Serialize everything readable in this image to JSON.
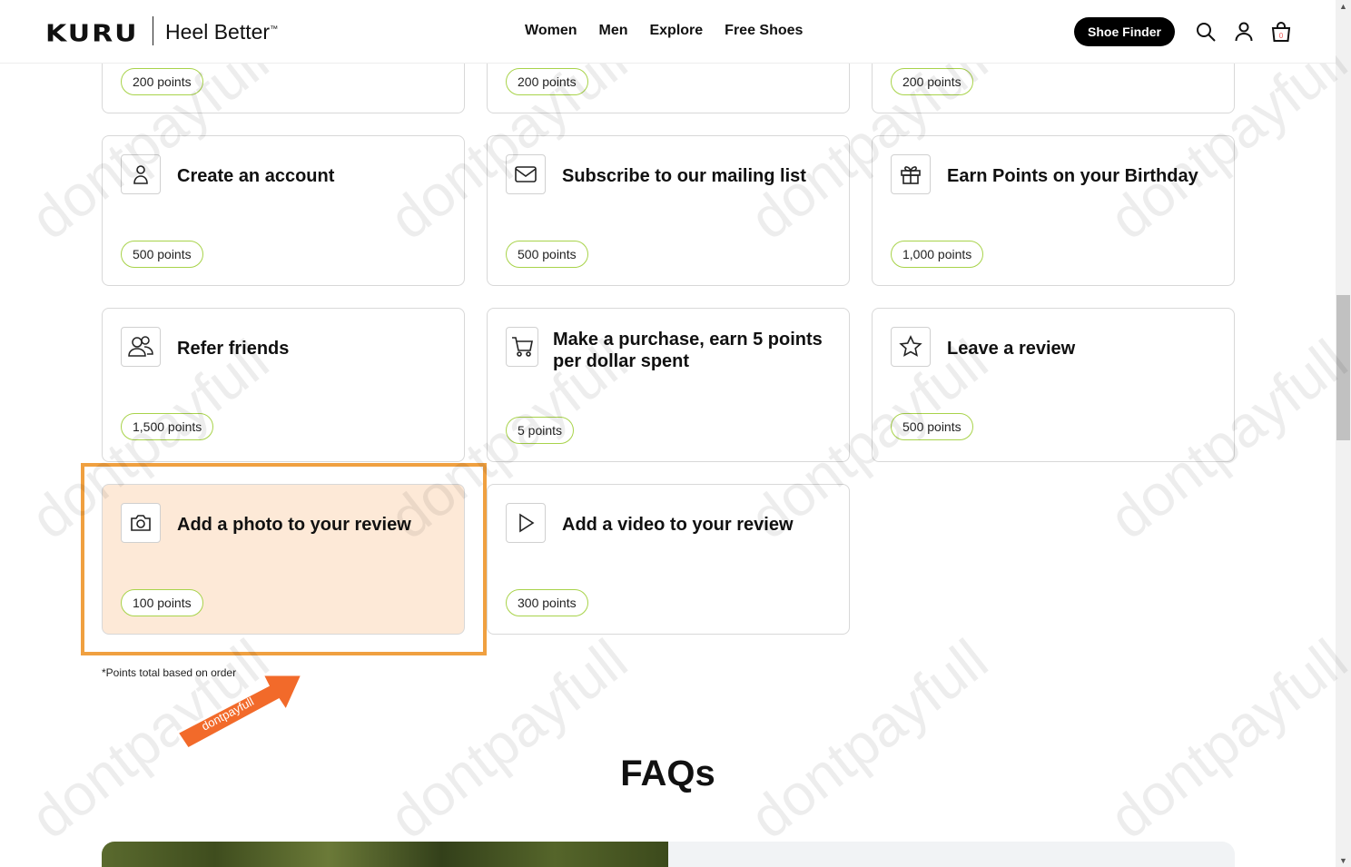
{
  "header": {
    "logo": "KURU",
    "tagline": "Heel Better",
    "tagline_mark": "™",
    "nav": [
      "Women",
      "Men",
      "Explore",
      "Free Shoes"
    ],
    "shoe_finder_label": "Shoe Finder",
    "cart_count": "0"
  },
  "top_row": [
    {
      "points": "200 points"
    },
    {
      "points": "200 points"
    },
    {
      "points": "200 points"
    }
  ],
  "cards": [
    {
      "title": "Create an account",
      "points": "500 points",
      "icon": "user-icon"
    },
    {
      "title": "Subscribe to our mailing list",
      "points": "500 points",
      "icon": "mail-icon"
    },
    {
      "title": "Earn Points on your Birthday",
      "points": "1,000 points",
      "icon": "gift-icon"
    },
    {
      "title": "Refer friends",
      "points": "1,500 points",
      "icon": "friends-icon"
    },
    {
      "title": "Make a purchase, earn 5 points per dollar spent",
      "points": "5 points",
      "icon": "cart-icon"
    },
    {
      "title": "Leave a review",
      "points": "500 points",
      "icon": "star-icon"
    },
    {
      "title": "Add a photo to your review",
      "points": "100 points",
      "icon": "camera-icon"
    },
    {
      "title": "Add a video to your review",
      "points": "300 points",
      "icon": "play-icon"
    }
  ],
  "footnote": "*Points total based on order",
  "faq_title": "FAQs",
  "watermark": "dontpayfull",
  "colors": {
    "points_border": "#a8d34a",
    "highlight_fill": "#fde9d7",
    "highlight_border": "#f0a040",
    "arrow": "#f26a2a"
  }
}
